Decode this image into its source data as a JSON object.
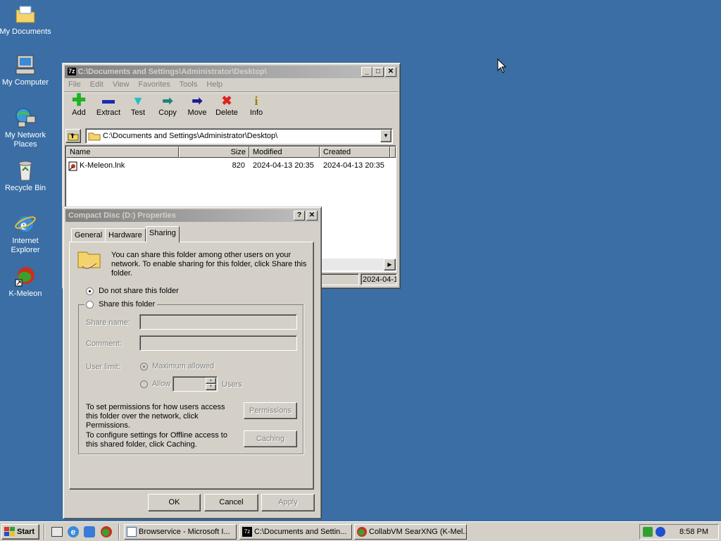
{
  "desktop": {
    "icons": [
      {
        "label": "My Documents"
      },
      {
        "label": "My Computer"
      },
      {
        "label": "My Network Places"
      },
      {
        "label": "Recycle Bin"
      },
      {
        "label": "Internet Explorer"
      },
      {
        "label": "K-Meleon"
      }
    ]
  },
  "explorer": {
    "title": "C:\\Documents and Settings\\Administrator\\Desktop\\",
    "menu": [
      "File",
      "Edit",
      "View",
      "Favorites",
      "Tools",
      "Help"
    ],
    "toolbar": [
      {
        "label": "Add",
        "icon": "plus-icon"
      },
      {
        "label": "Extract",
        "icon": "minus-icon"
      },
      {
        "label": "Test",
        "icon": "test-icon"
      },
      {
        "label": "Copy",
        "icon": "copy-arrow-icon"
      },
      {
        "label": "Move",
        "icon": "move-arrow-icon"
      },
      {
        "label": "Delete",
        "icon": "delete-x-icon"
      },
      {
        "label": "Info",
        "icon": "info-icon"
      }
    ],
    "address": "C:\\Documents and Settings\\Administrator\\Desktop\\",
    "columns": [
      "Name",
      "Size",
      "Modified",
      "Created"
    ],
    "rows": [
      {
        "name": "K-Meleon.lnk",
        "size": "820",
        "modified": "2024-04-13 20:35",
        "created": "2024-04-13 20:35"
      }
    ],
    "status_right": "2024-04-1"
  },
  "dialog": {
    "title": "Compact Disc (D:) Properties",
    "tabs": [
      "General",
      "Hardware",
      "Sharing"
    ],
    "active_tab": "Sharing",
    "intro": "You can share this folder among other users on your network.  To enable sharing for this folder, click Share this folder.",
    "opt_no_share": "Do not share this folder",
    "opt_share": "Share this folder",
    "share_name_label": "Share name:",
    "share_name_value": "",
    "comment_label": "Comment:",
    "comment_value": "",
    "user_limit_label": "User limit:",
    "max_allowed": "Maximum allowed",
    "allow": "Allow",
    "allow_value": "",
    "users": "Users",
    "perm_text": "To set permissions for how users access this folder over the network, click Permissions.",
    "perm_button": "Permissions",
    "cache_text": "To configure settings for Offline access to this shared folder, click Caching.",
    "cache_button": "Caching",
    "ok": "OK",
    "cancel": "Cancel",
    "apply": "Apply"
  },
  "taskbar": {
    "start": "Start",
    "tasks": [
      {
        "label": "Browservice - Microsoft I..."
      },
      {
        "label": "C:\\Documents and Settin..."
      },
      {
        "label": "CollabVM SearXNG (K-Mel..."
      }
    ],
    "clock": "8:58 PM"
  }
}
